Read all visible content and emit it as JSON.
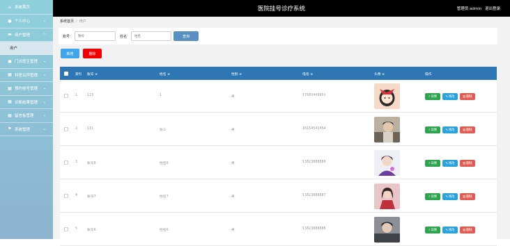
{
  "sidebar": {
    "items": [
      {
        "label": "系统首页",
        "icon": "home-icon"
      },
      {
        "label": "个人中心",
        "icon": "user-icon"
      },
      {
        "label": "用户管理",
        "icon": "chat-icon",
        "sub": "用户"
      },
      {
        "label": "门诊医生管理",
        "icon": "user-icon"
      },
      {
        "label": "科室名称管理",
        "icon": "grid-icon"
      },
      {
        "label": "预约挂号管理",
        "icon": "grid-icon"
      },
      {
        "label": "诊断结果管理",
        "icon": "grid-icon"
      },
      {
        "label": "留言板管理",
        "icon": "grid-icon"
      },
      {
        "label": "系统管理",
        "icon": "flag-icon"
      }
    ]
  },
  "header": {
    "title": "医院挂号诊疗系统",
    "user_label": "管理员 admin",
    "logout": "退出登录"
  },
  "breadcrumb": {
    "home": "系统首页",
    "separator": "/",
    "current": "用户"
  },
  "search": {
    "account_label": "账号",
    "account_placeholder": "账号",
    "name_label": "姓名",
    "name_placeholder": "姓名",
    "query_button": "查询"
  },
  "actions": {
    "add": "新增",
    "delete": "删除"
  },
  "table": {
    "headers": [
      "索引",
      "账号 ≑",
      "姓名 ≑",
      "性别 ≑",
      "电话 ≑",
      "头像 ≑",
      "操作"
    ],
    "rows": [
      {
        "index": "1",
        "account": "123",
        "name": "1",
        "gender": "男",
        "phone": "17680449901"
      },
      {
        "index": "2",
        "account": "111",
        "name": "张三",
        "gender": "男",
        "phone": "18154541454"
      },
      {
        "index": "3",
        "account": "账号8",
        "name": "姓名8",
        "gender": "男",
        "phone": "13823888888"
      },
      {
        "index": "4",
        "account": "账号7",
        "name": "姓名7",
        "gender": "男",
        "phone": "13823888887"
      },
      {
        "index": "5",
        "account": "账号6",
        "name": "姓名6",
        "gender": "男",
        "phone": "13823888886"
      }
    ],
    "row_actions": {
      "detail": "详情",
      "edit": "修改",
      "delete": "删除"
    }
  },
  "colors": {
    "header_bar": "#2d76b3",
    "topbar": "#000000",
    "add_button": "#3fa6ee",
    "delete_button": "#f20000"
  }
}
